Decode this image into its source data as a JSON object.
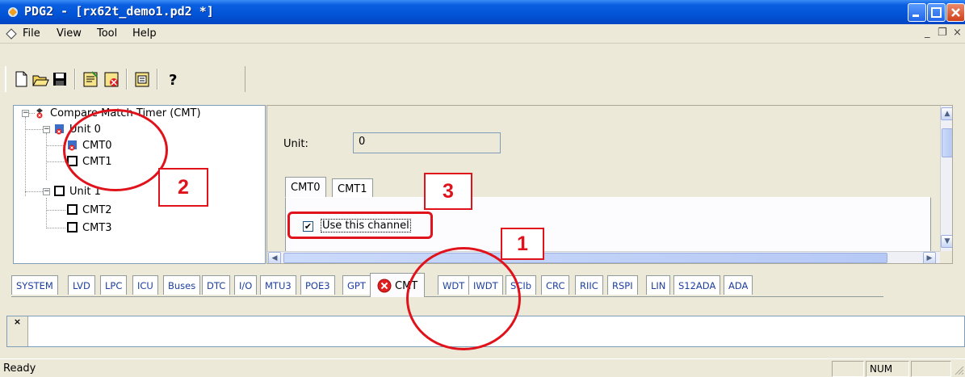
{
  "window": {
    "title": "PDG2 - [rx62t_demo1.pd2 *]"
  },
  "menu": {
    "items": [
      {
        "label": "File"
      },
      {
        "label": "View"
      },
      {
        "label": "Tool"
      },
      {
        "label": "Help"
      }
    ],
    "mdi_minimize": "_",
    "mdi_restore": "❐",
    "mdi_close": "×"
  },
  "toolbar": {
    "buttons": [
      "new-icon",
      "open-icon",
      "save-icon",
      "generate-icon",
      "check-icon",
      "report-icon",
      "help-icon"
    ]
  },
  "tree": {
    "root": "Compare Match Timer (CMT)",
    "unit0": "Unit 0",
    "cmt0": "CMT0",
    "cmt1": "CMT1",
    "unit1": "Unit 1",
    "cmt2": "CMT2",
    "cmt3": "CMT3"
  },
  "panel": {
    "unit_label": "Unit:",
    "unit_value": "0",
    "tabs": [
      "CMT0",
      "CMT1"
    ],
    "checkbox_label": "Use this channel",
    "checkbox_checked": true
  },
  "bottom_tabs": {
    "items": [
      "SYSTEM",
      "LVD",
      "LPC",
      "ICU",
      "Buses",
      "DTC",
      "I/O",
      "MTU3",
      "POE3",
      "GPT",
      "CMT",
      "WDT",
      "IWDT",
      "SCIb",
      "CRC",
      "RIIC",
      "RSPI",
      "LIN",
      "S12ADA",
      "ADA"
    ],
    "active": "CMT"
  },
  "output": {
    "grip": "×"
  },
  "status": {
    "text": "Ready",
    "num": "NUM"
  },
  "annotations": {
    "callout1": "1",
    "callout2": "2",
    "callout3": "3",
    "color": "#e0121b"
  }
}
